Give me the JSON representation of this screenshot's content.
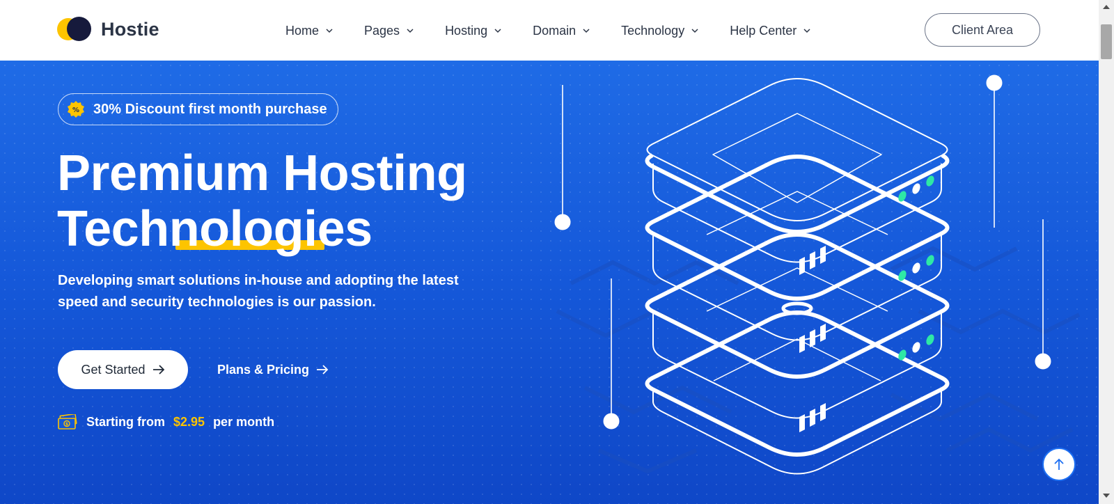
{
  "header": {
    "logo_text": "Hostie",
    "nav": [
      {
        "label": "Home"
      },
      {
        "label": "Pages"
      },
      {
        "label": "Hosting"
      },
      {
        "label": "Domain"
      },
      {
        "label": "Technology"
      },
      {
        "label": "Help Center"
      }
    ],
    "client_area_label": "Client Area"
  },
  "hero": {
    "badge_text": "30% Discount first month purchase",
    "title_line1": "Premium Hosting",
    "title_line2": "Technologies",
    "description": "Developing smart solutions in-house and adopting the latest speed and security technologies is our passion.",
    "get_started_label": "Get Started",
    "plans_label": "Plans & Pricing",
    "price_prefix": "Starting from",
    "price_amount": "$2.95",
    "price_suffix": "per month"
  },
  "colors": {
    "accent_yellow": "#fdc400",
    "hero_blue": "#1558d9",
    "dark_navy": "#161a3c",
    "led_green": "#2ee8a5"
  },
  "icons": {
    "badge": "discount-badge-icon",
    "nav_chevron": "chevron-down-icon",
    "button_arrow": "arrow-right-icon",
    "price": "money-bill-icon",
    "scroll_top": "arrow-up-icon"
  }
}
